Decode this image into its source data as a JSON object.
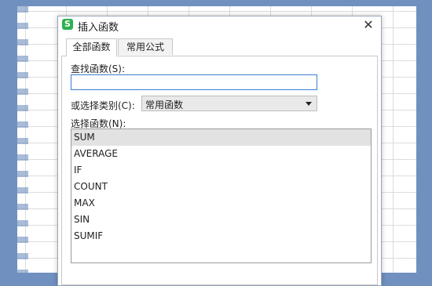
{
  "dialog": {
    "icon_glyph": "S",
    "title": "插入函数",
    "close_glyph": "✕"
  },
  "tabs": [
    {
      "label": "全部函数",
      "active": true
    },
    {
      "label": "常用公式",
      "active": false
    }
  ],
  "search": {
    "label": "查找函数(S):",
    "value": "",
    "placeholder": ""
  },
  "category": {
    "label": "或选择类别(C):",
    "selected": "常用函数"
  },
  "functions": {
    "label": "选择函数(N):",
    "items": [
      "SUM",
      "AVERAGE",
      "IF",
      "COUNT",
      "MAX",
      "SIN",
      "SUMIF"
    ],
    "selected_index": 0
  },
  "colors": {
    "accent": "#3b7fd1",
    "app_icon": "#2db14d",
    "background": "#7090bf"
  }
}
